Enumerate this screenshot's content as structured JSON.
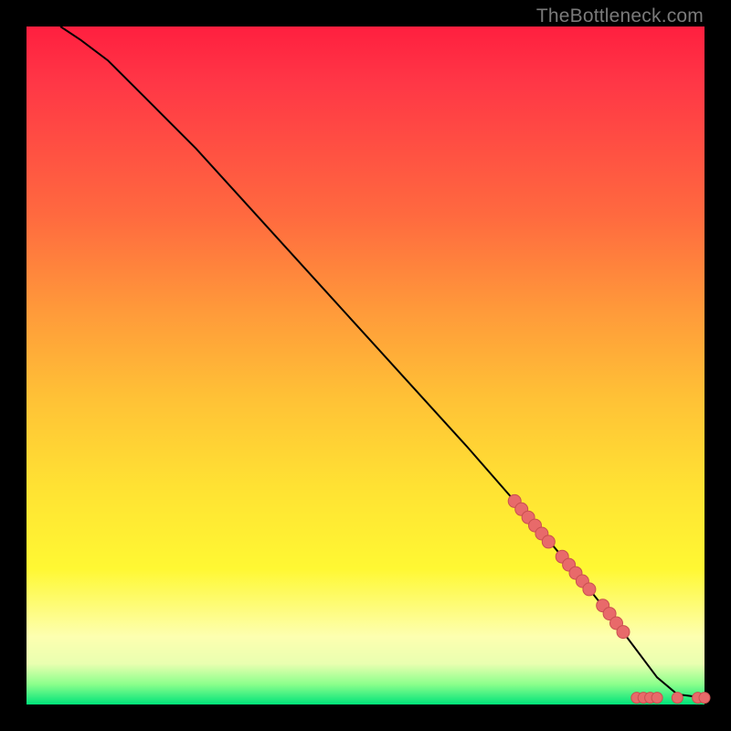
{
  "attribution": "TheBottleneck.com",
  "colors": {
    "plot_top": "#ff1f3f",
    "plot_bottom": "#00e37a",
    "curve_stroke": "#000000",
    "marker_fill": "#e86a6a",
    "marker_stroke": "#c94f4f",
    "page_bg": "#000000",
    "attribution_text": "#7a7a7a"
  },
  "chart_data": {
    "type": "line",
    "title": "",
    "xlabel": "",
    "ylabel": "",
    "xlim": [
      0,
      100
    ],
    "ylim": [
      0,
      100
    ],
    "curve": {
      "x": [
        5,
        8,
        12,
        18,
        25,
        35,
        45,
        55,
        65,
        72,
        78,
        83,
        87,
        90,
        93,
        96,
        100
      ],
      "y": [
        100,
        98,
        95,
        89,
        82,
        71,
        60,
        49,
        38,
        30,
        23,
        17,
        12,
        8,
        4,
        1.5,
        1
      ]
    },
    "markers_on_curve": {
      "x": [
        72,
        73,
        74,
        75,
        76,
        77,
        79,
        80,
        81,
        82,
        83,
        85,
        86,
        87,
        88
      ],
      "y": [
        30.0,
        28.8,
        27.6,
        26.4,
        25.2,
        24.0,
        21.8,
        20.6,
        19.4,
        18.2,
        17.0,
        14.6,
        13.4,
        12.0,
        10.7
      ]
    },
    "markers_tail": {
      "x": [
        90,
        91,
        92,
        93,
        96,
        99,
        100
      ],
      "y": [
        1,
        1,
        1,
        1,
        1,
        1,
        1
      ]
    }
  }
}
